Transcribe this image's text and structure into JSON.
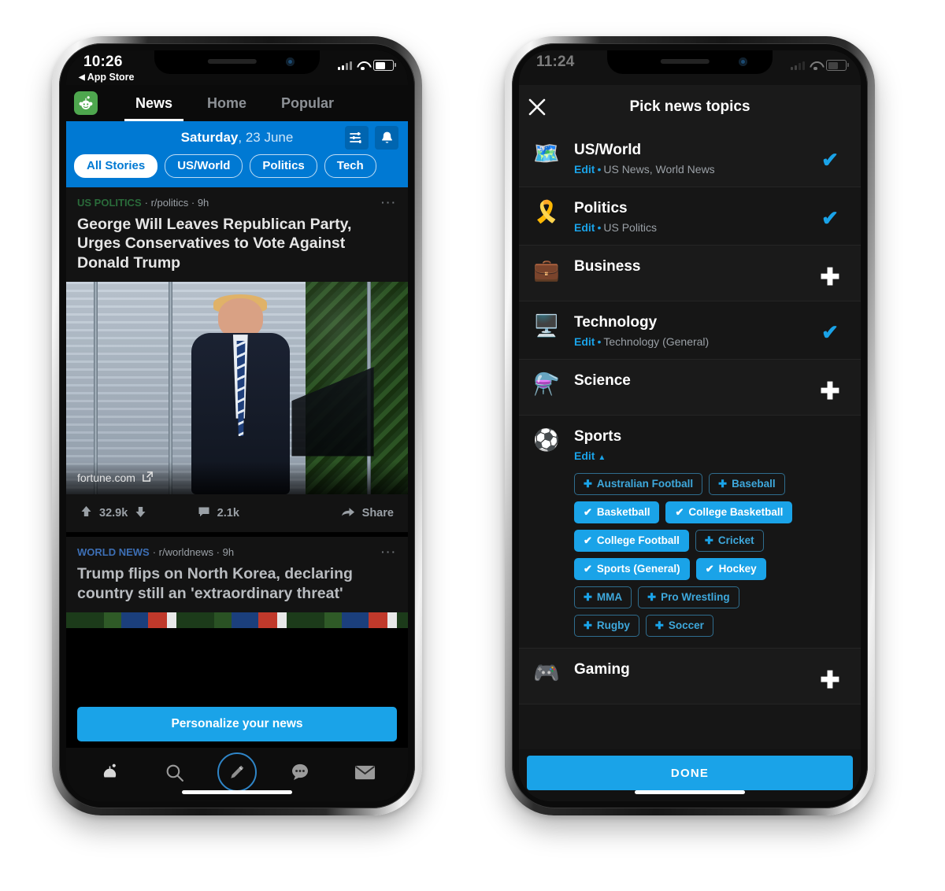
{
  "left_phone": {
    "status_bar": {
      "time": "10:26",
      "back_label": "App Store",
      "back_arrow": "◀"
    },
    "top_nav": {
      "app_icon": "snoo-green-icon",
      "tabs": [
        {
          "label": "News",
          "active": true
        },
        {
          "label": "Home",
          "active": false
        },
        {
          "label": "Popular",
          "active": false
        }
      ]
    },
    "blue_header": {
      "day": "Saturday",
      "date": ", 23 June",
      "icons": [
        "sliders-icon",
        "bell-icon"
      ],
      "chips": [
        {
          "label": "All Stories",
          "selected": true
        },
        {
          "label": "US/World",
          "selected": false
        },
        {
          "label": "Politics",
          "selected": false
        },
        {
          "label": "Tech",
          "selected": false
        }
      ]
    },
    "posts": [
      {
        "category": "US POLITICS",
        "subreddit": "r/politics",
        "age": "9h",
        "overflow": "···",
        "title": "George Will Leaves Republican Party, Urges Conservatives to Vote Against Donald Trump",
        "source": "fortune.com",
        "upvotes": "32.9k",
        "comments": "2.1k",
        "share_label": "Share"
      },
      {
        "category": "WORLD NEWS",
        "subreddit": "r/worldnews",
        "age": "9h",
        "overflow": "···",
        "title": "Trump flips on North Korea, declaring country still an 'extraordinary threat'"
      }
    ],
    "cta_label": "Personalize your news",
    "bottom_nav": [
      {
        "name": "home-snoo-icon"
      },
      {
        "name": "search-icon"
      },
      {
        "name": "create-post-icon"
      },
      {
        "name": "chat-icon"
      },
      {
        "name": "inbox-icon"
      }
    ]
  },
  "right_phone": {
    "status_bar": {
      "time": "11:24"
    },
    "header": {
      "title": "Pick news topics",
      "close_icon": "close-icon"
    },
    "done_label": "DONE",
    "topics": [
      {
        "emoji": "🗺️",
        "icon_name": "us-map-icon",
        "name": "US/World",
        "edit_label": "Edit",
        "subtitle": "US News, World News",
        "action": "check",
        "selected": true
      },
      {
        "emoji": "🎗️",
        "icon_name": "election-rosette-icon",
        "name": "Politics",
        "edit_label": "Edit",
        "subtitle": "US Politics",
        "action": "check",
        "selected": true
      },
      {
        "emoji": "💼",
        "icon_name": "briefcase-icon",
        "name": "Business",
        "edit_label": "",
        "subtitle": "",
        "action": "plus",
        "selected": false
      },
      {
        "emoji": "🖥️",
        "icon_name": "computer-icon",
        "name": "Technology",
        "edit_label": "Edit",
        "subtitle": "Technology (General)",
        "action": "check",
        "selected": true
      },
      {
        "emoji": "⚗️",
        "icon_name": "flask-icon",
        "name": "Science",
        "edit_label": "",
        "subtitle": "",
        "action": "plus",
        "selected": false
      },
      {
        "emoji": "⚽",
        "icon_name": "soccer-ball-icon",
        "name": "Sports",
        "edit_label": "Edit",
        "edit_caret": "▲",
        "subtitle": "",
        "action": "none",
        "expanded": true,
        "subtopics": [
          {
            "label": "Australian Football",
            "selected": false
          },
          {
            "label": "Baseball",
            "selected": false
          },
          {
            "label": "Basketball",
            "selected": true
          },
          {
            "label": "College Basketball",
            "selected": true
          },
          {
            "label": "College Football",
            "selected": true
          },
          {
            "label": "Cricket",
            "selected": false
          },
          {
            "label": "Sports (General)",
            "selected": true
          },
          {
            "label": "Hockey",
            "selected": true
          },
          {
            "label": "MMA",
            "selected": false
          },
          {
            "label": "Pro Wrestling",
            "selected": false
          },
          {
            "label": "Rugby",
            "selected": false
          },
          {
            "label": "Soccer",
            "selected": false
          }
        ]
      },
      {
        "emoji": "🎮",
        "icon_name": "game-controller-icon",
        "name": "Gaming",
        "edit_label": "",
        "subtitle": "",
        "action": "plus",
        "selected": false
      }
    ]
  },
  "colors": {
    "accent_blue": "#1aa3e8",
    "header_blue": "#0079d3",
    "app_bg": "#0d0d0d",
    "card_bg": "#131313",
    "muted_text": "#9aa0a6",
    "category_politics": "#2a6b3a",
    "category_world": "#3d6fb5",
    "page_bg": "#ffffff"
  }
}
